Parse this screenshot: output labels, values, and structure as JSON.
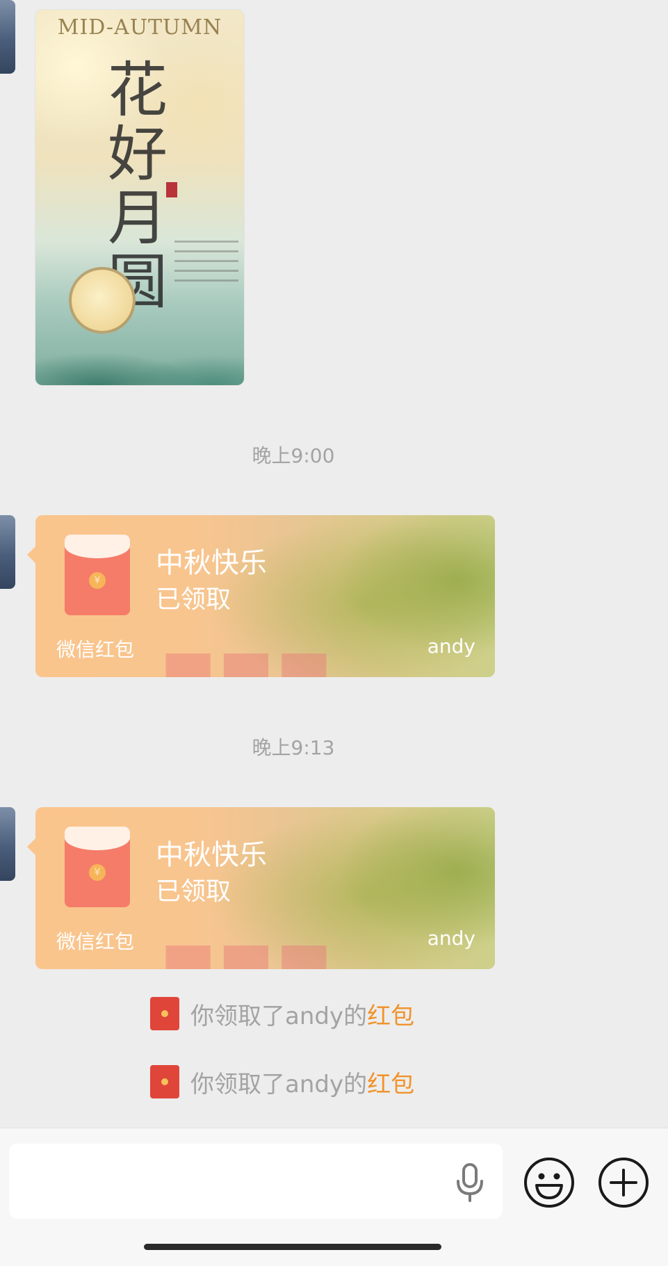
{
  "messages": {
    "poster": {
      "heading": "MID-AUTUMN",
      "calligraphy": "花好月圆"
    },
    "timestamps": [
      "晚上9:00",
      "晚上9:13"
    ],
    "red_packets": [
      {
        "title": "中秋快乐",
        "status": "已领取",
        "brand": "微信红包",
        "sender": "andy"
      },
      {
        "title": "中秋快乐",
        "status": "已领取",
        "brand": "微信红包",
        "sender": "andy"
      }
    ],
    "system_notices": [
      {
        "text": "你领取了andy的",
        "link": "红包"
      },
      {
        "text": "你领取了andy的",
        "link": "红包"
      }
    ]
  },
  "input_bar": {
    "placeholder": "",
    "icons": [
      "microphone-icon",
      "emoji-icon",
      "plus-icon"
    ]
  },
  "colors": {
    "background": "#ededed",
    "packet_orange": "#fac58c",
    "notice_link": "#f0932c",
    "notice_icon": "#e0453a"
  }
}
